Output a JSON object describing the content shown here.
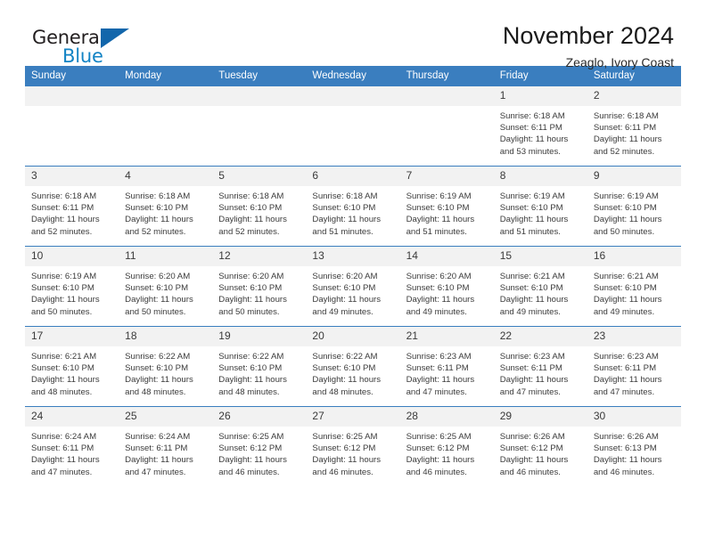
{
  "brand": {
    "name_part1": "General",
    "name_part2": "Blue",
    "triangle_color": "#1266ab",
    "blue_color": "#1283c4"
  },
  "header": {
    "title": "November 2024",
    "subtitle": "Zeaglo, Ivory Coast"
  },
  "theme": {
    "header_blue": "#3a7ebf",
    "daynum_background": "#f2f2f2",
    "text_color": "#3b3b3b"
  },
  "weekday_headers": [
    "Sunday",
    "Monday",
    "Tuesday",
    "Wednesday",
    "Thursday",
    "Friday",
    "Saturday"
  ],
  "labels": {
    "sunrise_prefix": "Sunrise:",
    "sunset_prefix": "Sunset:",
    "daylight_prefix": "Daylight:"
  },
  "weeks": [
    [
      {
        "day": "",
        "blank": true,
        "line1": "",
        "line2": "",
        "line3": "",
        "line4": ""
      },
      {
        "day": "",
        "blank": true,
        "line1": "",
        "line2": "",
        "line3": "",
        "line4": ""
      },
      {
        "day": "",
        "blank": true,
        "line1": "",
        "line2": "",
        "line3": "",
        "line4": ""
      },
      {
        "day": "",
        "blank": true,
        "line1": "",
        "line2": "",
        "line3": "",
        "line4": ""
      },
      {
        "day": "",
        "blank": true,
        "line1": "",
        "line2": "",
        "line3": "",
        "line4": ""
      },
      {
        "day": "1",
        "blank": false,
        "line1": "Sunrise: 6:18 AM",
        "line2": "Sunset: 6:11 PM",
        "line3": "Daylight: 11 hours",
        "line4": "and 53 minutes."
      },
      {
        "day": "2",
        "blank": false,
        "line1": "Sunrise: 6:18 AM",
        "line2": "Sunset: 6:11 PM",
        "line3": "Daylight: 11 hours",
        "line4": "and 52 minutes."
      }
    ],
    [
      {
        "day": "3",
        "blank": false,
        "line1": "Sunrise: 6:18 AM",
        "line2": "Sunset: 6:11 PM",
        "line3": "Daylight: 11 hours",
        "line4": "and 52 minutes."
      },
      {
        "day": "4",
        "blank": false,
        "line1": "Sunrise: 6:18 AM",
        "line2": "Sunset: 6:10 PM",
        "line3": "Daylight: 11 hours",
        "line4": "and 52 minutes."
      },
      {
        "day": "5",
        "blank": false,
        "line1": "Sunrise: 6:18 AM",
        "line2": "Sunset: 6:10 PM",
        "line3": "Daylight: 11 hours",
        "line4": "and 52 minutes."
      },
      {
        "day": "6",
        "blank": false,
        "line1": "Sunrise: 6:18 AM",
        "line2": "Sunset: 6:10 PM",
        "line3": "Daylight: 11 hours",
        "line4": "and 51 minutes."
      },
      {
        "day": "7",
        "blank": false,
        "line1": "Sunrise: 6:19 AM",
        "line2": "Sunset: 6:10 PM",
        "line3": "Daylight: 11 hours",
        "line4": "and 51 minutes."
      },
      {
        "day": "8",
        "blank": false,
        "line1": "Sunrise: 6:19 AM",
        "line2": "Sunset: 6:10 PM",
        "line3": "Daylight: 11 hours",
        "line4": "and 51 minutes."
      },
      {
        "day": "9",
        "blank": false,
        "line1": "Sunrise: 6:19 AM",
        "line2": "Sunset: 6:10 PM",
        "line3": "Daylight: 11 hours",
        "line4": "and 50 minutes."
      }
    ],
    [
      {
        "day": "10",
        "blank": false,
        "line1": "Sunrise: 6:19 AM",
        "line2": "Sunset: 6:10 PM",
        "line3": "Daylight: 11 hours",
        "line4": "and 50 minutes."
      },
      {
        "day": "11",
        "blank": false,
        "line1": "Sunrise: 6:20 AM",
        "line2": "Sunset: 6:10 PM",
        "line3": "Daylight: 11 hours",
        "line4": "and 50 minutes."
      },
      {
        "day": "12",
        "blank": false,
        "line1": "Sunrise: 6:20 AM",
        "line2": "Sunset: 6:10 PM",
        "line3": "Daylight: 11 hours",
        "line4": "and 50 minutes."
      },
      {
        "day": "13",
        "blank": false,
        "line1": "Sunrise: 6:20 AM",
        "line2": "Sunset: 6:10 PM",
        "line3": "Daylight: 11 hours",
        "line4": "and 49 minutes."
      },
      {
        "day": "14",
        "blank": false,
        "line1": "Sunrise: 6:20 AM",
        "line2": "Sunset: 6:10 PM",
        "line3": "Daylight: 11 hours",
        "line4": "and 49 minutes."
      },
      {
        "day": "15",
        "blank": false,
        "line1": "Sunrise: 6:21 AM",
        "line2": "Sunset: 6:10 PM",
        "line3": "Daylight: 11 hours",
        "line4": "and 49 minutes."
      },
      {
        "day": "16",
        "blank": false,
        "line1": "Sunrise: 6:21 AM",
        "line2": "Sunset: 6:10 PM",
        "line3": "Daylight: 11 hours",
        "line4": "and 49 minutes."
      }
    ],
    [
      {
        "day": "17",
        "blank": false,
        "line1": "Sunrise: 6:21 AM",
        "line2": "Sunset: 6:10 PM",
        "line3": "Daylight: 11 hours",
        "line4": "and 48 minutes."
      },
      {
        "day": "18",
        "blank": false,
        "line1": "Sunrise: 6:22 AM",
        "line2": "Sunset: 6:10 PM",
        "line3": "Daylight: 11 hours",
        "line4": "and 48 minutes."
      },
      {
        "day": "19",
        "blank": false,
        "line1": "Sunrise: 6:22 AM",
        "line2": "Sunset: 6:10 PM",
        "line3": "Daylight: 11 hours",
        "line4": "and 48 minutes."
      },
      {
        "day": "20",
        "blank": false,
        "line1": "Sunrise: 6:22 AM",
        "line2": "Sunset: 6:10 PM",
        "line3": "Daylight: 11 hours",
        "line4": "and 48 minutes."
      },
      {
        "day": "21",
        "blank": false,
        "line1": "Sunrise: 6:23 AM",
        "line2": "Sunset: 6:11 PM",
        "line3": "Daylight: 11 hours",
        "line4": "and 47 minutes."
      },
      {
        "day": "22",
        "blank": false,
        "line1": "Sunrise: 6:23 AM",
        "line2": "Sunset: 6:11 PM",
        "line3": "Daylight: 11 hours",
        "line4": "and 47 minutes."
      },
      {
        "day": "23",
        "blank": false,
        "line1": "Sunrise: 6:23 AM",
        "line2": "Sunset: 6:11 PM",
        "line3": "Daylight: 11 hours",
        "line4": "and 47 minutes."
      }
    ],
    [
      {
        "day": "24",
        "blank": false,
        "line1": "Sunrise: 6:24 AM",
        "line2": "Sunset: 6:11 PM",
        "line3": "Daylight: 11 hours",
        "line4": "and 47 minutes."
      },
      {
        "day": "25",
        "blank": false,
        "line1": "Sunrise: 6:24 AM",
        "line2": "Sunset: 6:11 PM",
        "line3": "Daylight: 11 hours",
        "line4": "and 47 minutes."
      },
      {
        "day": "26",
        "blank": false,
        "line1": "Sunrise: 6:25 AM",
        "line2": "Sunset: 6:12 PM",
        "line3": "Daylight: 11 hours",
        "line4": "and 46 minutes."
      },
      {
        "day": "27",
        "blank": false,
        "line1": "Sunrise: 6:25 AM",
        "line2": "Sunset: 6:12 PM",
        "line3": "Daylight: 11 hours",
        "line4": "and 46 minutes."
      },
      {
        "day": "28",
        "blank": false,
        "line1": "Sunrise: 6:25 AM",
        "line2": "Sunset: 6:12 PM",
        "line3": "Daylight: 11 hours",
        "line4": "and 46 minutes."
      },
      {
        "day": "29",
        "blank": false,
        "line1": "Sunrise: 6:26 AM",
        "line2": "Sunset: 6:12 PM",
        "line3": "Daylight: 11 hours",
        "line4": "and 46 minutes."
      },
      {
        "day": "30",
        "blank": false,
        "line1": "Sunrise: 6:26 AM",
        "line2": "Sunset: 6:13 PM",
        "line3": "Daylight: 11 hours",
        "line4": "and 46 minutes."
      }
    ]
  ]
}
